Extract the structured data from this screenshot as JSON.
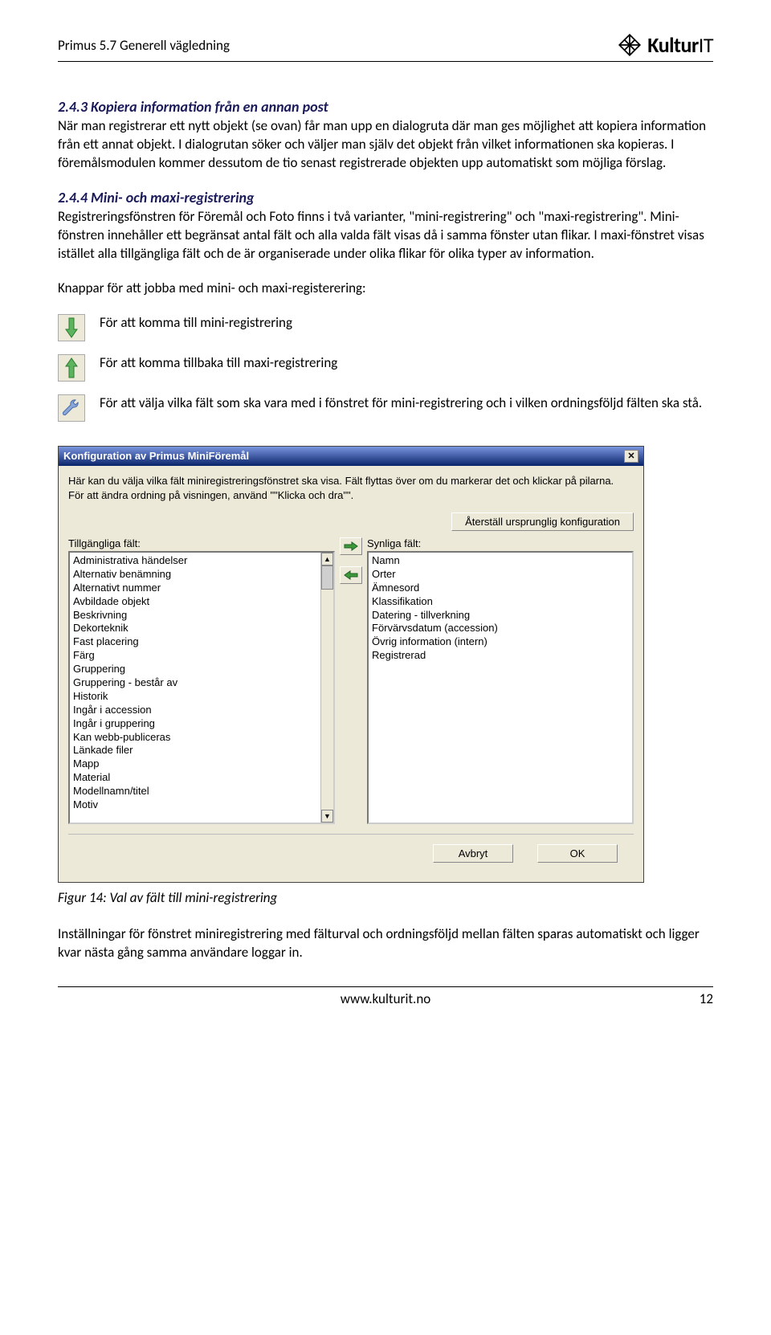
{
  "header": {
    "left": "Primus 5.7 Generell vägledning",
    "brand_bold": "Kultur",
    "brand_thin": "IT"
  },
  "section243": {
    "title": "2.4.3 Kopiera information från en annan post",
    "body": "När man registrerar ett nytt objekt (se ovan) får man upp en dialogruta där man ges möjlighet att kopiera information från ett annat objekt. I dialogrutan söker och väljer man själv det objekt från vilket informationen ska kopieras. I föremålsmodulen kommer dessutom de tio senast registrerade objekten upp automatiskt som möjliga förslag."
  },
  "section244": {
    "title": "2.4.4 Mini- och maxi-registrering",
    "body": "Registreringsfönstren för Föremål och Foto finns i två varianter, \"mini-registrering\" och \"maxi-registrering\". Mini-fönstren innehåller ett begränsat antal fält och alla valda fält visas då i samma fönster utan flikar. I maxi-fönstret visas istället alla tillgängliga fält och de är organiserade under olika flikar för olika typer av information.",
    "buttons_intro": "Knappar för att jobba med mini- och maxi-registerering:",
    "icon1_label": "För att komma till mini-registrering",
    "icon2_label": "För att komma tillbaka till maxi-registrering",
    "icon3_label": "För att välja vilka fält som ska vara med i fönstret för mini-registrering och i vilken ordningsföljd fälten ska stå."
  },
  "dialog": {
    "title": "Konfiguration av Primus MiniFöremål",
    "intro": "Här kan du välja vilka fält miniregistreringsfönstret ska visa. Fält flyttas över om du markerar det och klickar på pilarna.\nFör att ändra ordning på visningen, använd \"\"Klicka och dra\"\".",
    "reset_button": "Återställ ursprunglig konfiguration",
    "left_label": "Tillgängliga fält:",
    "right_label": "Synliga fält:",
    "left_items": [
      "Administrativa händelser",
      "Alternativ benämning",
      "Alternativt nummer",
      "Avbildade objekt",
      "Beskrivning",
      "Dekorteknik",
      "Fast placering",
      "Färg",
      "Gruppering",
      "Gruppering - består av",
      "Historik",
      "Ingår i accession",
      "Ingår i gruppering",
      "Kan webb-publiceras",
      "Länkade filer",
      "Mapp",
      "Material",
      "Modellnamn/titel",
      "Motiv"
    ],
    "right_items": [
      "Namn",
      "Orter",
      "Ämnesord",
      "Klassifikation",
      "Datering - tillverkning",
      "Förvärvsdatum (accession)",
      "Övrig information (intern)",
      "Registrerad"
    ],
    "cancel": "Avbryt",
    "ok": "OK"
  },
  "figure_caption": "Figur 14: Val av fält till mini-registrering",
  "closing": "Inställningar för fönstret miniregistrering med fälturval och ordningsföljd mellan fälten sparas automatiskt och ligger kvar nästa gång samma användare loggar in.",
  "footer": {
    "url": "www.kulturit.no",
    "page": "12"
  }
}
